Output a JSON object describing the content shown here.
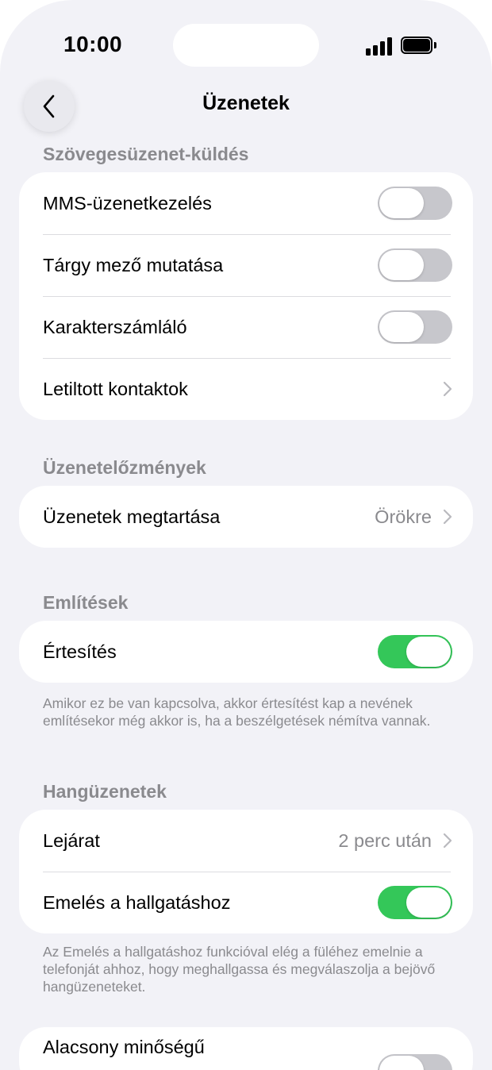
{
  "status_bar": {
    "time": "10:00",
    "signal_icon": "cellular-signal-icon",
    "battery_icon": "battery-icon"
  },
  "nav": {
    "back_icon": "chevron-left-icon",
    "title": "Üzenetek"
  },
  "sections": {
    "text_messaging": {
      "header": "Szövegesüzenet-küldés",
      "rows": [
        {
          "label": "MMS-üzenetkezelés",
          "toggle": "off"
        },
        {
          "label": "Tárgy mező mutatása",
          "toggle": "off"
        },
        {
          "label": "Karakterszámláló",
          "toggle": "off"
        },
        {
          "label": "Letiltott kontaktok",
          "chevron": true
        }
      ]
    },
    "history": {
      "header": "Üzenetelőzmények",
      "rows": [
        {
          "label": "Üzenetek megtartása",
          "value": "Örökre",
          "chevron": true
        }
      ]
    },
    "mentions": {
      "header": "Említések",
      "rows": [
        {
          "label": "Értesítés",
          "toggle": "on"
        }
      ],
      "footer": "Amikor ez be van kapcsolva, akkor értesítést kap a nevének említésekor még akkor is, ha a beszélgetések némítva vannak."
    },
    "audio": {
      "header": "Hangüzenetek",
      "rows": [
        {
          "label": "Lejárat",
          "value": "2 perc után",
          "chevron": true
        },
        {
          "label": "Emelés a hallgatáshoz",
          "toggle": "on"
        }
      ],
      "footer": "Az Emelés a hallgatáshoz funkcióval elég a füléhez emelnie a telefonját ahhoz, hogy meghallgassa és megválaszolja a bejövő hangüzeneteket."
    },
    "low_quality": {
      "rows": [
        {
          "label": "Alacsony minőségű",
          "toggle": "off"
        }
      ]
    }
  },
  "colors": {
    "background": "#f2f2f7",
    "toggle_on": "#34c759",
    "toggle_off": "#c7c7cc",
    "secondary_text": "#8a8a8e"
  }
}
